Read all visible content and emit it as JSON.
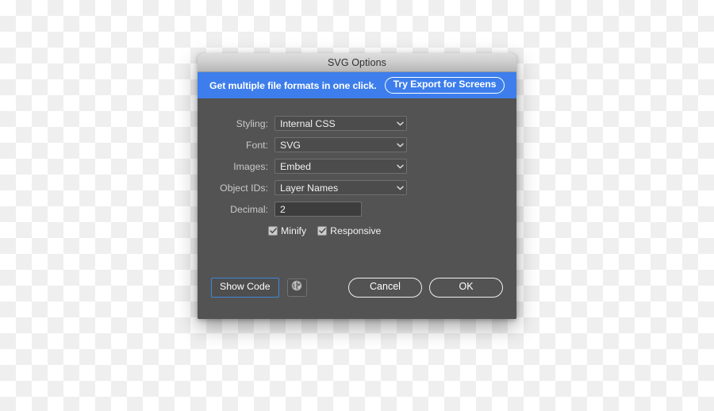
{
  "dialog": {
    "title": "SVG Options",
    "promo": {
      "text": "Get multiple file formats in one click.",
      "button_label": "Try Export for Screens",
      "background_color": "#3d7eec"
    },
    "fields": [
      {
        "label": "Styling:",
        "value": "Internal CSS",
        "type": "select"
      },
      {
        "label": "Font:",
        "value": "SVG",
        "type": "select"
      },
      {
        "label": "Images:",
        "value": "Embed",
        "type": "select"
      },
      {
        "label": "Object IDs:",
        "value": "Layer Names",
        "type": "select"
      },
      {
        "label": "Decimal:",
        "value": "2",
        "type": "text"
      }
    ],
    "checkboxes": [
      {
        "label": "Minify",
        "checked": true
      },
      {
        "label": "Responsive",
        "checked": true
      }
    ],
    "footer": {
      "show_code_label": "Show Code",
      "globe_icon": "globe-icon",
      "cancel_label": "Cancel",
      "ok_label": "OK",
      "focus_color": "#3f87d8"
    }
  }
}
